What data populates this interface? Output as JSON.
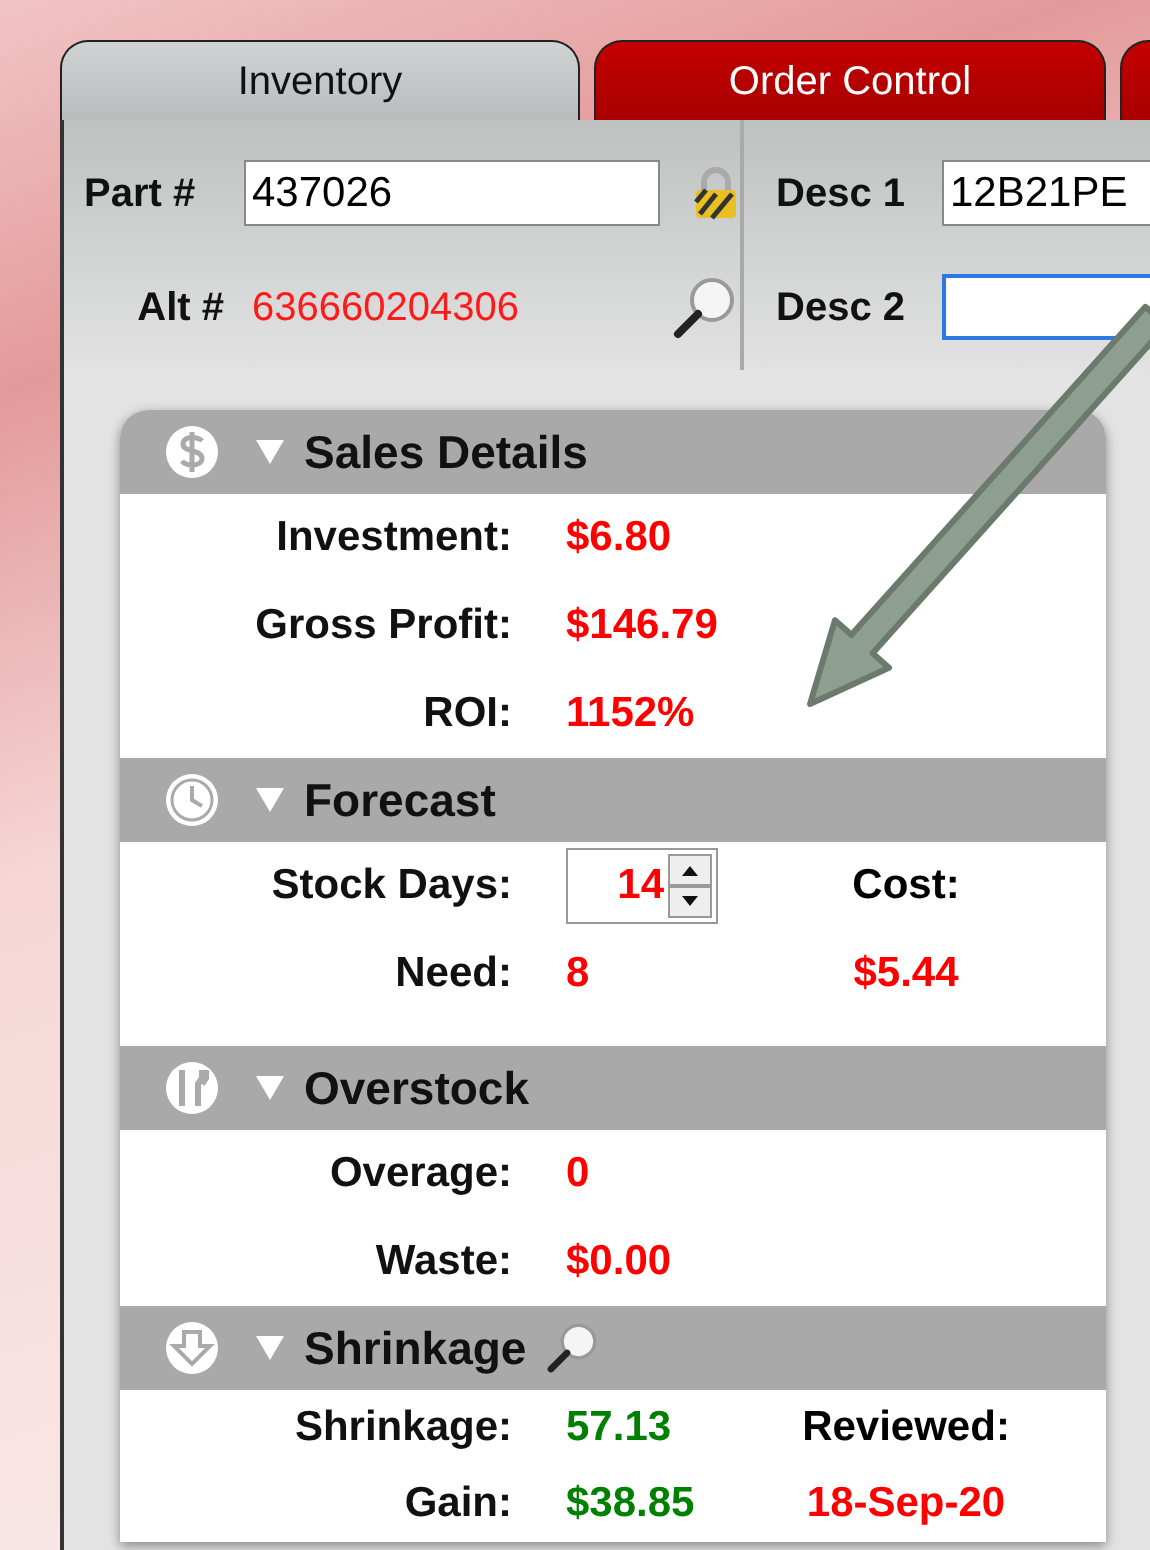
{
  "tabs": [
    {
      "label": "Inventory",
      "selected": true
    },
    {
      "label": "Order Control",
      "selected": false
    },
    {
      "selected": false
    }
  ],
  "header": {
    "part": {
      "label": "Part #",
      "value": "437026"
    },
    "alt": {
      "label": "Alt #",
      "value": "636660204306"
    },
    "desc_1": {
      "label": "Desc 1",
      "value": "12B21PE",
      "focused": false
    },
    "desc_2": {
      "label": "Desc 2",
      "focused": true
    }
  },
  "sections": [
    {
      "title": "Sales Details",
      "expanded": true,
      "rows": [
        {
          "label": "Investment:",
          "value": "$6.80",
          "color": "#ff0000",
          "kind": "text"
        },
        {
          "label": "Gross Profit:",
          "value": "$146.79",
          "color": "#ff0000",
          "kind": "text"
        },
        {
          "label": "ROI:",
          "value": "1152%",
          "color": "#ff0000",
          "kind": "text"
        }
      ]
    },
    {
      "title": "Forecast",
      "expanded": true,
      "rows": [
        {
          "label": "Stock Days:",
          "value": "14",
          "color": "#ff0000",
          "kind": "spinner",
          "right": {
            "text": "Cost:",
            "color": "#000000"
          }
        },
        {
          "label": "Need:",
          "value": "8",
          "color": "#ff0000",
          "kind": "text",
          "right": {
            "text": "$5.44",
            "color": "#ff0000"
          }
        }
      ]
    },
    {
      "title": "Overstock",
      "expanded": true,
      "rows": [
        {
          "label": "Overage:",
          "value": "0",
          "color": "#ff0000",
          "kind": "text"
        },
        {
          "label": "Waste:",
          "value": "$0.00",
          "color": "#ff0000",
          "kind": "text"
        }
      ]
    },
    {
      "title": "Shrinkage",
      "expanded": true,
      "search": true,
      "rows": [
        {
          "label": "Shrinkage:",
          "value": "57.13",
          "color": "#008000",
          "kind": "text",
          "right": {
            "text": "Reviewed:",
            "color": "#000000"
          }
        },
        {
          "label": "Gain:",
          "value": "$38.85",
          "color": "#008000",
          "kind": "text",
          "right": {
            "text": "18-Sep-20",
            "color": "#ff0000"
          }
        }
      ]
    }
  ]
}
